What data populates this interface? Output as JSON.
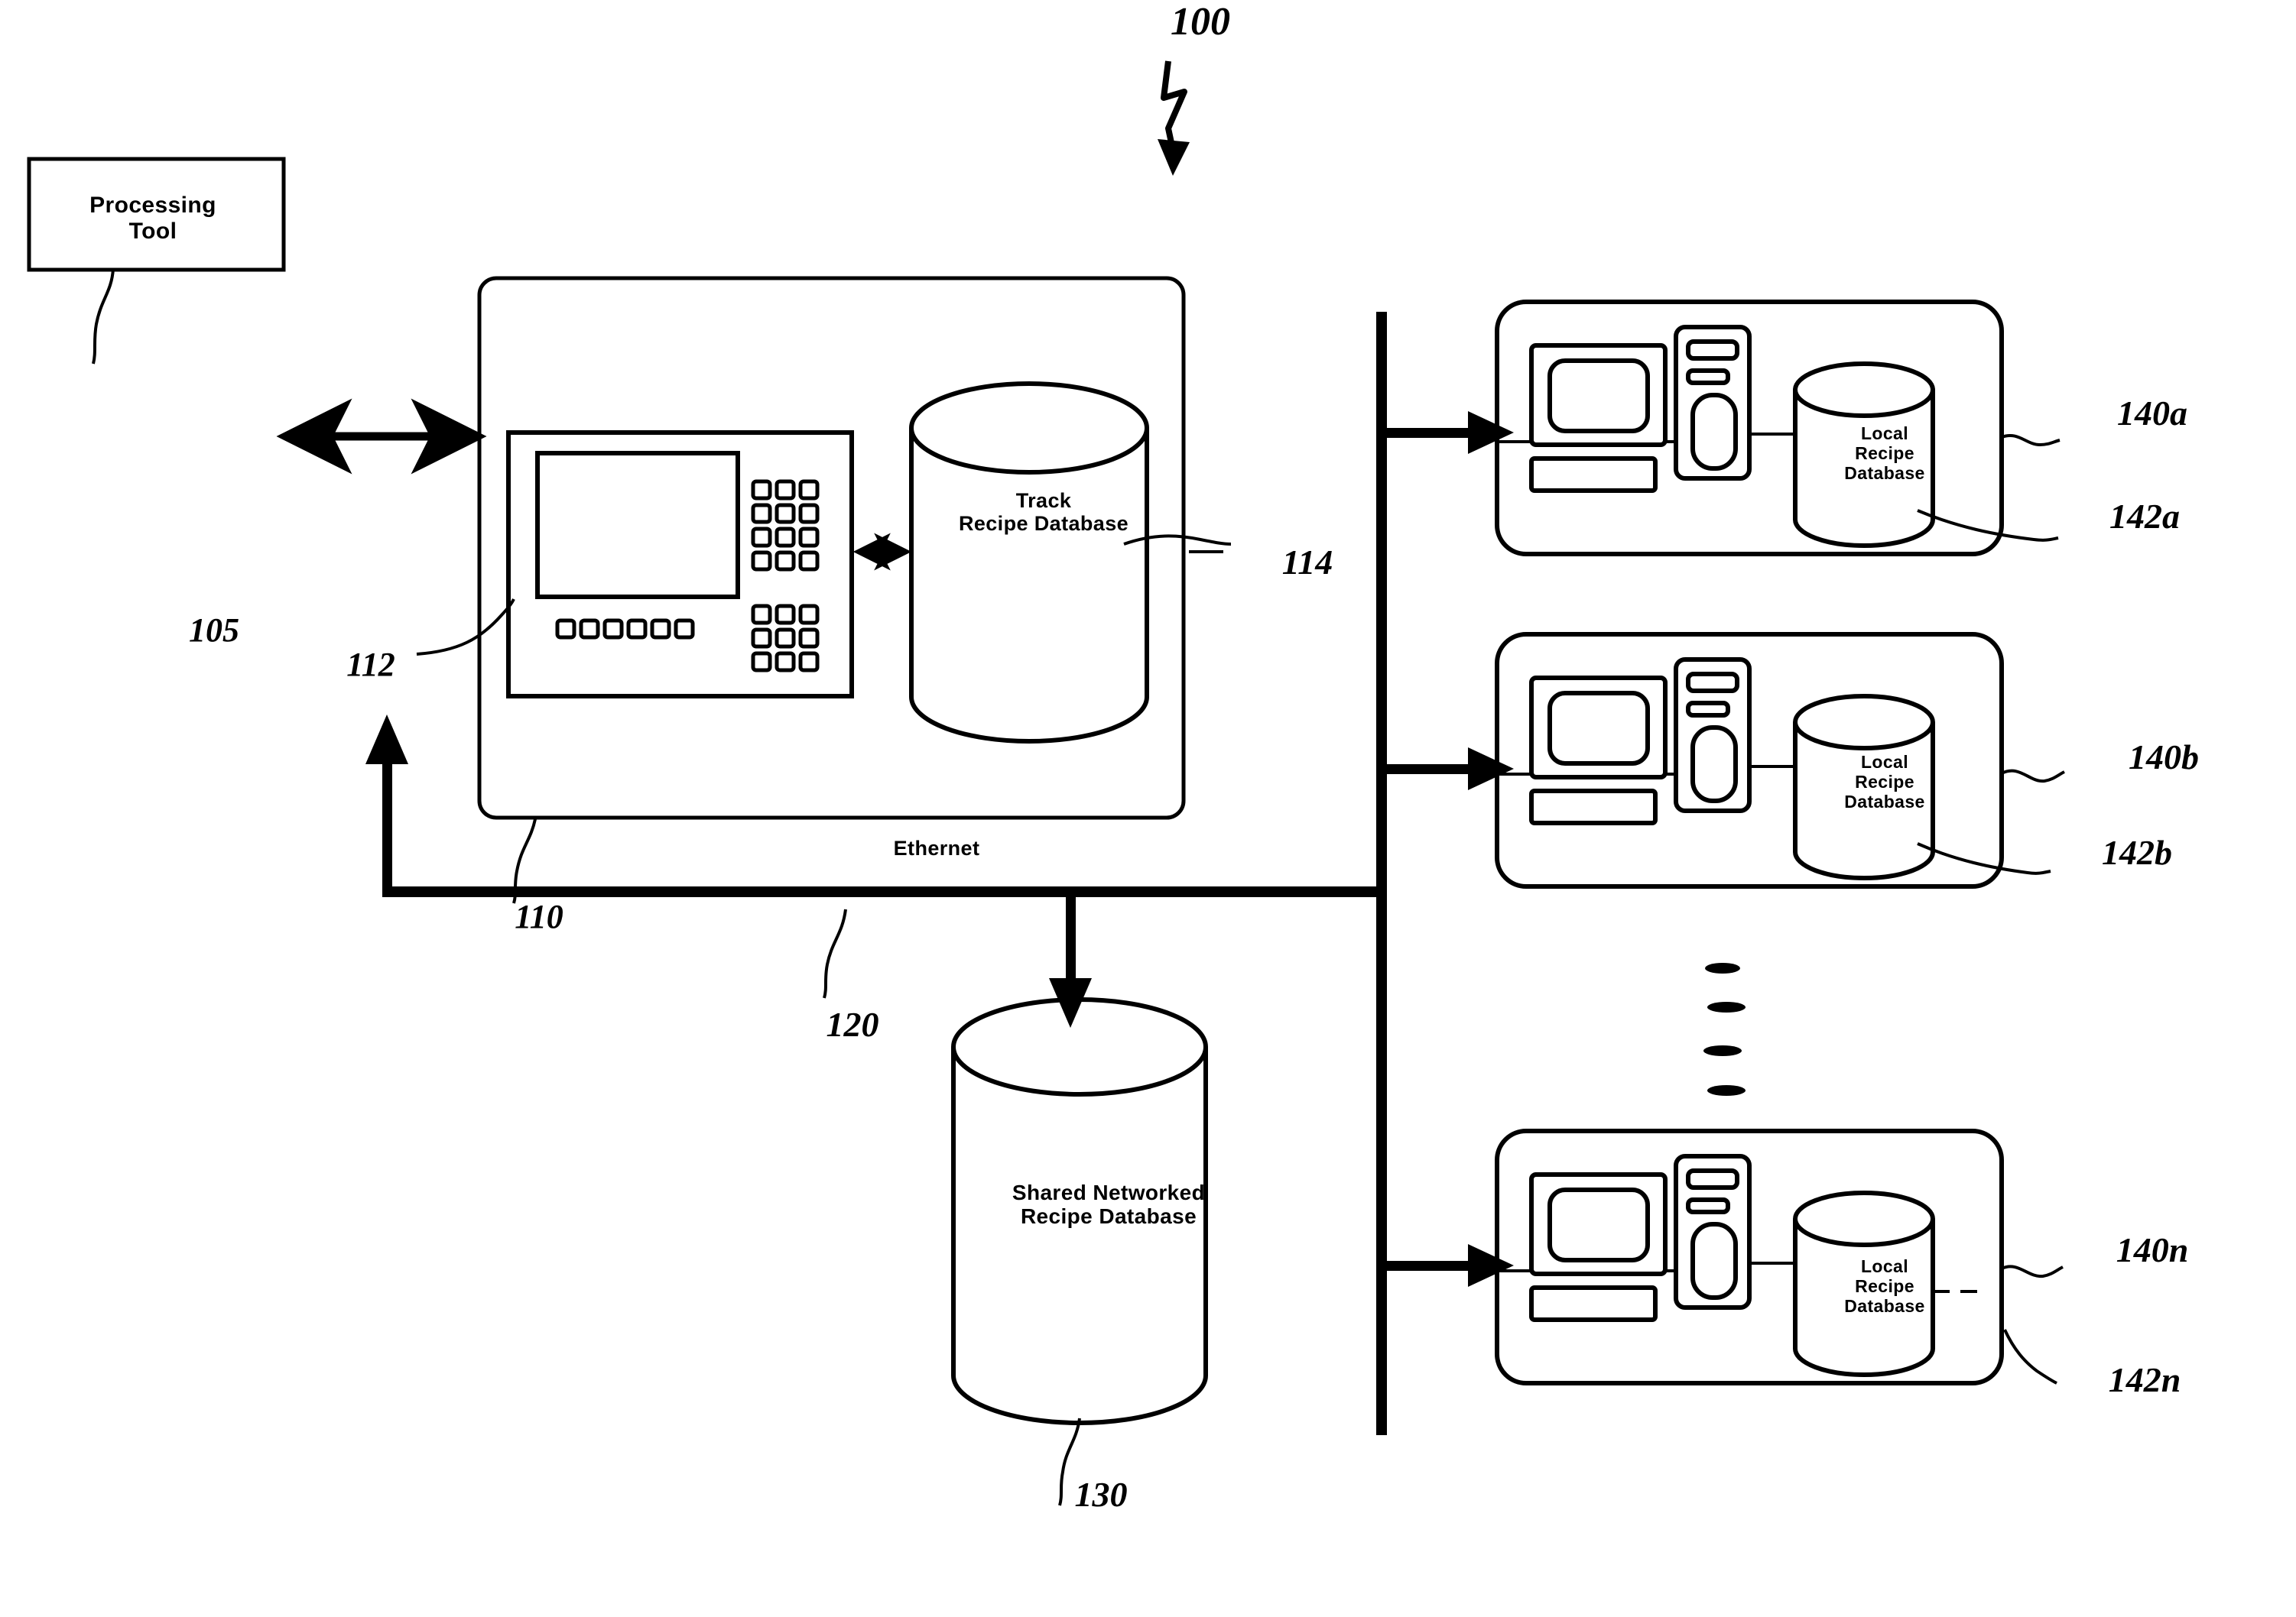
{
  "figure": {
    "ref_number": "100",
    "type": "patent-figure",
    "description": "Semiconductor processing track recipe distribution system block diagram"
  },
  "blocks": {
    "processing_tool": {
      "label": "Processing\nTool",
      "ref": "105"
    },
    "track_system": {
      "ref": "110"
    },
    "track_terminal": {
      "ref": "112"
    },
    "track_recipe_database": {
      "label": "Track\nRecipe Database",
      "ref": "114"
    },
    "network": {
      "label": "Ethernet",
      "ref": "120"
    },
    "shared_database": {
      "label": "Shared Networked\nRecipe Database",
      "ref": "130"
    },
    "workstations": [
      {
        "ref": "140a",
        "db_ref": "142a",
        "db_label": "Local\nRecipe\nDatabase"
      },
      {
        "ref": "140b",
        "db_ref": "142b",
        "db_label": "Local\nRecipe\nDatabase"
      },
      {
        "ref": "140n",
        "db_ref": "142n",
        "db_label": "Local\nRecipe\nDatabase"
      }
    ],
    "ellipsis": {
      "marks": 4
    }
  },
  "colors": {
    "ink": "#000000",
    "paper": "#ffffff"
  }
}
